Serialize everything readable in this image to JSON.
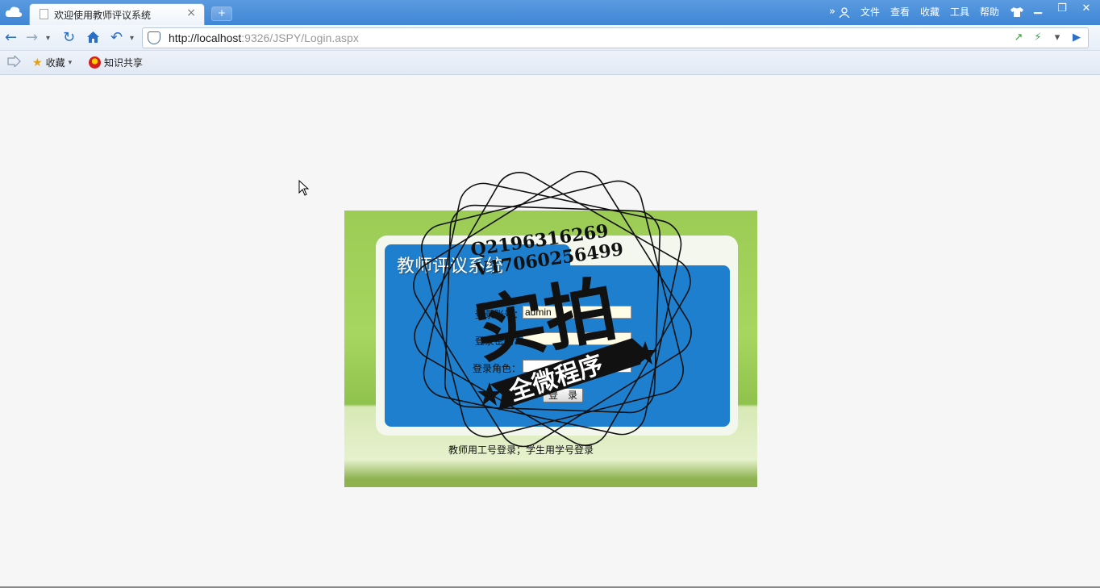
{
  "browser": {
    "tab_title": "欢迎使用教师评议系统",
    "tab_close": "×",
    "new_tab": "+",
    "menu": [
      "文件",
      "查看",
      "收藏",
      "工具",
      "帮助"
    ],
    "menu_more": "»",
    "url_host": "http://localhost",
    "url_path": ":9326/JSPY/Login.aspx"
  },
  "favorites": {
    "items": [
      {
        "label": "收藏",
        "icon": "star-add-icon"
      },
      {
        "label": "知识共享",
        "icon": "share-logo-icon"
      }
    ]
  },
  "login": {
    "system_title": "教师评议系统",
    "username_label": "登录账号：",
    "username_value": "admin",
    "password_label": "登录密码：",
    "role_label": "登录角色：",
    "login_button": "登　录",
    "hint": "教师用工号登录；学生用学号登录"
  },
  "watermark": {
    "qq1": "Q2196316269",
    "qq2": "V17060256499",
    "main": "实拍",
    "sub": "全微程序"
  },
  "colors": {
    "titlebar": "#4a90dd",
    "panel_green": "#a7d660",
    "panel_blue": "#1e7fcf"
  }
}
